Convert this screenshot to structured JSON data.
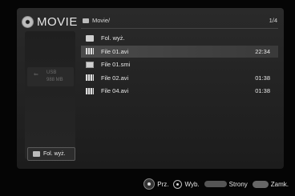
{
  "header": {
    "title": "MOVIE",
    "path": "Movie/",
    "page": "1/4"
  },
  "sidebar": {
    "device_label": "USB",
    "device_size": "988 MB",
    "folder_button": "Fol. wyż."
  },
  "files": [
    {
      "name": "Fol. wyż.",
      "type": "folder",
      "time": ""
    },
    {
      "name": "File 01.avi",
      "type": "video",
      "time": "22:34"
    },
    {
      "name": "File 01.smi",
      "type": "subtitle",
      "time": ""
    },
    {
      "name": "File 02.avi",
      "type": "video",
      "time": "01:38"
    },
    {
      "name": "File 04.avi",
      "type": "video",
      "time": "01:38"
    }
  ],
  "footer": {
    "move": "Prz.",
    "select": "Wyb.",
    "pages": "Strony",
    "close": "Zamk."
  }
}
